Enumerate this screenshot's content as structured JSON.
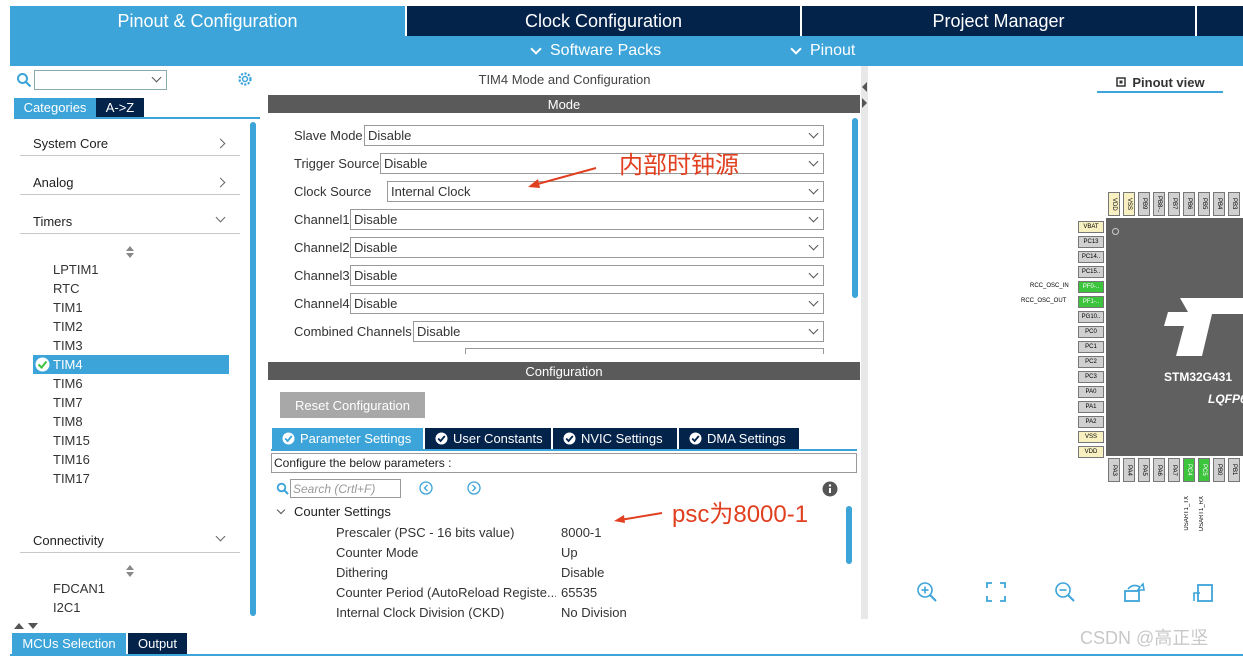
{
  "top_tabs": [
    "Pinout & Configuration",
    "Clock Configuration",
    "Project Manager"
  ],
  "sub_menu": [
    "Software Packs",
    "Pinout"
  ],
  "left": {
    "category_tabs": [
      "Categories",
      "A->Z"
    ],
    "categories": [
      "System Core",
      "Analog",
      "Timers",
      "Connectivity"
    ],
    "timers": [
      "LPTIM1",
      "RTC",
      "TIM1",
      "TIM2",
      "TIM3",
      "TIM4",
      "TIM6",
      "TIM7",
      "TIM8",
      "TIM15",
      "TIM16",
      "TIM17"
    ],
    "connectivity": [
      "FDCAN1",
      "I2C1"
    ],
    "selected_timer": "TIM4"
  },
  "mode": {
    "title": "TIM4 Mode and Configuration",
    "header": "Mode",
    "rows": [
      {
        "label": "Slave Mode",
        "value": "Disable"
      },
      {
        "label": "Trigger Source",
        "value": "Disable"
      },
      {
        "label": "Clock Source",
        "value": "Internal Clock"
      },
      {
        "label": "Channel1",
        "value": "Disable"
      },
      {
        "label": "Channel2",
        "value": "Disable"
      },
      {
        "label": "Channel3",
        "value": "Disable"
      },
      {
        "label": "Channel4",
        "value": "Disable"
      },
      {
        "label": "Combined Channels",
        "value": "Disable"
      }
    ]
  },
  "configuration": {
    "header": "Configuration",
    "reset_label": "Reset Configuration",
    "tabs": [
      "Parameter Settings",
      "User Constants",
      "NVIC Settings",
      "DMA Settings"
    ],
    "hint": "Configure the below parameters :",
    "search_placeholder": "Search (Crtl+F)",
    "section": "Counter Settings",
    "params": [
      {
        "name": "Prescaler (PSC - 16 bits value)",
        "value": "8000-1"
      },
      {
        "name": "Counter Mode",
        "value": "Up"
      },
      {
        "name": "Dithering",
        "value": "Disable"
      },
      {
        "name": "Counter Period (AutoReload Registe...",
        "value": "65535"
      },
      {
        "name": "Internal Clock Division (CKD)",
        "value": "No Division"
      }
    ]
  },
  "annotations": {
    "clock": "内部时钟源",
    "psc": "psc为8000-1"
  },
  "pinout": {
    "tab": "Pinout view",
    "chip_name": "STM32G431",
    "package": "LQFP6",
    "left_pins": [
      "VBAT",
      "PC13",
      "PC14..",
      "PC15..",
      "PF0-..",
      "PF1-..",
      "PG10..",
      "PC0",
      "PC1",
      "PC2",
      "PC3",
      "PA0",
      "PA1",
      "PA2",
      "VSS",
      "VDD"
    ],
    "top_pins": [
      "VDD",
      "VSS",
      "PB9",
      "PB8-..",
      "PB7",
      "PB6",
      "PB5",
      "PB4",
      "PB3"
    ],
    "bottom_pins": [
      "PA3",
      "PA4",
      "PA5",
      "PA6",
      "PA7",
      "PC4",
      "PC5",
      "PB0",
      "PB1"
    ],
    "signals": [
      "RCC_OSC_IN",
      "RCC_OSC_OUT",
      "USART1_TX",
      "USART1_RX"
    ]
  },
  "bottom_tabs": [
    "MCUs Selection",
    "Output"
  ],
  "watermark": "CSDN @高正坚",
  "colors": {
    "navy": "#03234b",
    "blue": "#3ca4d9",
    "header_gray": "#5a5a5a",
    "annotation": "#e04020",
    "pin_green": "#3cc43c"
  }
}
